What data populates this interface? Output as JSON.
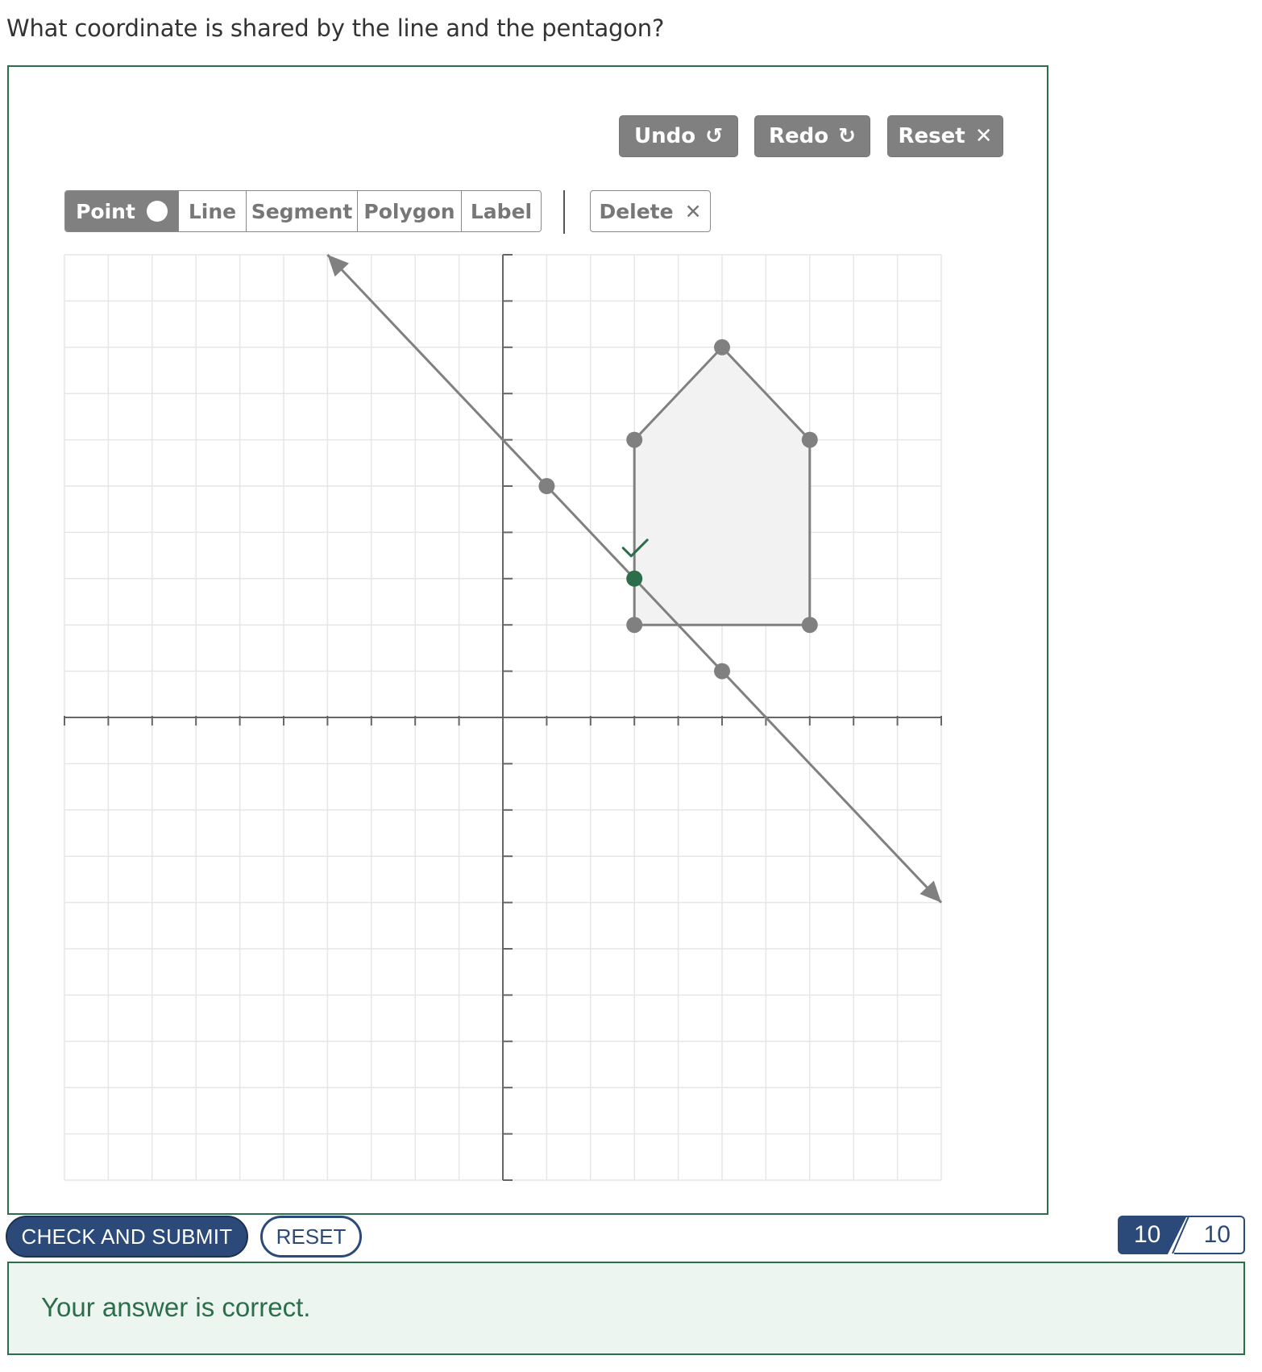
{
  "question": "What coordinate is shared by the line and the pentagon?",
  "history_buttons": {
    "undo": {
      "label": "Undo",
      "icon": "undo-icon",
      "glyph": "↺"
    },
    "redo": {
      "label": "Redo",
      "icon": "redo-icon",
      "glyph": "↻"
    },
    "reset": {
      "label": "Reset",
      "icon": "close-icon",
      "glyph": "✕"
    }
  },
  "tools": [
    {
      "label": "Point",
      "active": true
    },
    {
      "label": "Line",
      "active": false
    },
    {
      "label": "Segment",
      "active": false
    },
    {
      "label": "Polygon",
      "active": false
    },
    {
      "label": "Label",
      "active": false
    }
  ],
  "delete_button": {
    "label": "Delete",
    "icon": "close-icon",
    "glyph": "✕"
  },
  "graph": {
    "x_range": [
      -10,
      10
    ],
    "y_range": [
      -10,
      10
    ],
    "grid": true,
    "line": {
      "through": [
        [
          1,
          5
        ],
        [
          5,
          1
        ]
      ],
      "extends_both_ways": true
    },
    "pentagon": {
      "vertices": [
        [
          3,
          2
        ],
        [
          3,
          6
        ],
        [
          5,
          8
        ],
        [
          7,
          6
        ],
        [
          7,
          2
        ]
      ]
    },
    "answer_point": {
      "coords": [
        3,
        3
      ],
      "status": "correct"
    },
    "colors": {
      "shape": "#808080",
      "fill": "#f2f2f2",
      "grid": "#e6e6e6",
      "axis": "#666666",
      "correct": "#2c6e49"
    }
  },
  "actions": {
    "submit_label": "CHECK AND SUBMIT",
    "reset_label": "RESET"
  },
  "score": {
    "earned": "10",
    "total": "10"
  },
  "feedback": {
    "text": "Your answer is correct."
  },
  "colors": {
    "primary": "#2b4a7a",
    "success": "#2c6e49",
    "success_bg": "#edf5f1"
  }
}
